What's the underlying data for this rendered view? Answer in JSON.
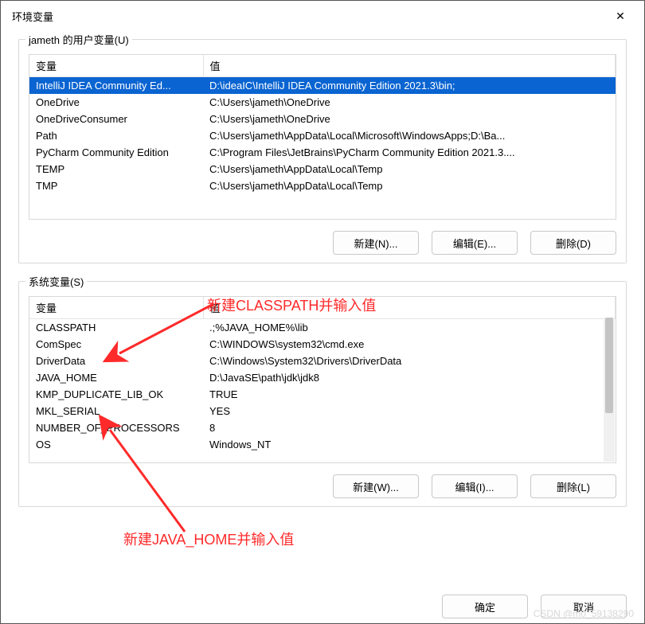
{
  "window": {
    "title": "环境变量",
    "close_glyph": "✕"
  },
  "user_vars": {
    "group_label": "jameth 的用户变量(U)",
    "col_var": "变量",
    "col_val": "值",
    "rows": [
      {
        "var": "IntelliJ IDEA Community Ed...",
        "val": "D:\\ideaIC\\IntelliJ IDEA Community Edition 2021.3\\bin;",
        "selected": true
      },
      {
        "var": "OneDrive",
        "val": "C:\\Users\\jameth\\OneDrive"
      },
      {
        "var": "OneDriveConsumer",
        "val": "C:\\Users\\jameth\\OneDrive"
      },
      {
        "var": "Path",
        "val": "C:\\Users\\jameth\\AppData\\Local\\Microsoft\\WindowsApps;D:\\Ba..."
      },
      {
        "var": "PyCharm Community Edition",
        "val": "C:\\Program Files\\JetBrains\\PyCharm Community Edition 2021.3...."
      },
      {
        "var": "TEMP",
        "val": "C:\\Users\\jameth\\AppData\\Local\\Temp"
      },
      {
        "var": "TMP",
        "val": "C:\\Users\\jameth\\AppData\\Local\\Temp"
      }
    ],
    "btn_new": "新建(N)...",
    "btn_edit": "编辑(E)...",
    "btn_delete": "删除(D)"
  },
  "sys_vars": {
    "group_label": "系统变量(S)",
    "col_var": "变量",
    "col_val": "值",
    "rows": [
      {
        "var": "CLASSPATH",
        "val": ".;%JAVA_HOME%\\lib"
      },
      {
        "var": "ComSpec",
        "val": "C:\\WINDOWS\\system32\\cmd.exe"
      },
      {
        "var": "DriverData",
        "val": "C:\\Windows\\System32\\Drivers\\DriverData"
      },
      {
        "var": "JAVA_HOME",
        "val": "D:\\JavaSE\\path\\jdk\\jdk8"
      },
      {
        "var": "KMP_DUPLICATE_LIB_OK",
        "val": "TRUE"
      },
      {
        "var": "MKL_SERIAL",
        "val": "YES"
      },
      {
        "var": "NUMBER_OF_PROCESSORS",
        "val": "8"
      },
      {
        "var": "OS",
        "val": "Windows_NT"
      }
    ],
    "btn_new": "新建(W)...",
    "btn_edit": "编辑(I)...",
    "btn_delete": "删除(L)"
  },
  "footer": {
    "ok": "确定",
    "cancel": "取消"
  },
  "annotations": {
    "text1": "新建CLASSPATH并输入值",
    "text2": "新建JAVA_HOME并输入值"
  },
  "watermark": "CSDN @m0_59138290"
}
